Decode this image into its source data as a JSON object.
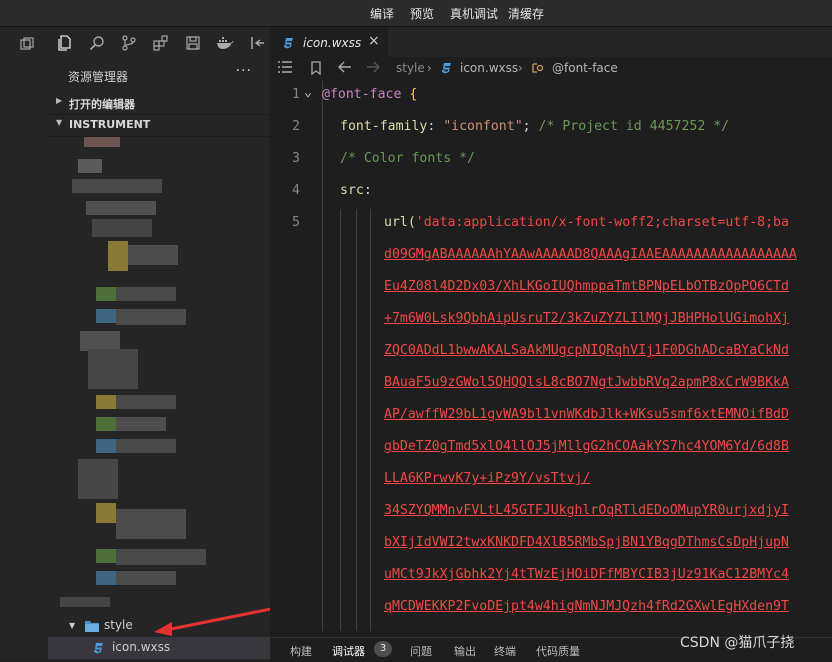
{
  "menu": [
    "编译",
    "预览",
    "真机调试",
    "清缓存"
  ],
  "tab": {
    "label": "icon.wxss",
    "close": "×"
  },
  "breadcrumb": {
    "folder": "style",
    "file": "icon.wxss",
    "symbol": "@font-face"
  },
  "explorer": {
    "title": "资源管理器",
    "more": "···",
    "open_editors": "打开的编辑器",
    "project": "INSTRUMENT",
    "folder": "style",
    "file": "icon.wxss"
  },
  "code": {
    "line_numbers": [
      "1",
      "2",
      "3",
      "4",
      "5"
    ],
    "lines": [
      {
        "l1_at": "@font-face",
        "l1_brace": "{"
      },
      {
        "prop": "font-family",
        "colon": ": ",
        "str": "\"iconfont\"",
        "semi": "; ",
        "comment": "/* Project id 4457252 */"
      },
      {
        "comment": "/* Color fonts */"
      },
      {
        "prop": "src",
        "colon": ":"
      },
      {
        "fn": "url(",
        "str": "'data:application/x-font-woff2;charset=utf-8;ba"
      }
    ],
    "data_lines": [
      "d09GMgABAAAAAAhYAAwAAAAAD8QAAAgIAAEAAAAAAAAAAAAAAAAA",
      "Eu4Z08l4D2Dx03/XhLKGoIUQhmppaTmtBPNpELbOTBzOpPO6CTd",
      "+7m6W0Lsk9QbhAipUsruT2/3kZuZYZLIlMQjJBHPHolUGimohXj",
      "ZQC0ADdL1bwwAKALSaAkMUgcpNIQRqhVIj1F0DGhADcaBYaCkNd",
      "BAuaF5u9zGWol5QHQQlsL8cBO7NgtJwbbRVq2apmP8xCrW9BKkA",
      "AP/awffW29bL1gvWA9bl1vnWKdbJlk+WKsu5smf6xtEMNOifBdD",
      "gbDeTZ0gTmd5xlO4llOJ5jMllgG2hCOAakYS7hc4YOM6Yd/6d8B",
      "LLA6KPrwvK7y+iPz9Y/vsTtvj/",
      "34SZYQMMnvFVLtL45GTFJUkghlrOqRTldEDoOMupYR0urjxdjyI",
      "bXIjIdVWI2twxKNKDFD4XlB5RMbSpjBN1YBqgDThmsCsDpHjupN",
      "uMCt9JkXjGbhk2Yj4tTWzEjHOiDFfMBYCIB3jUz91KaC12BMYc4",
      "qMCDWEKKP2FvoDEjpt4w4higNmNJMJQzh4fRd2GXwlEgHXden9T"
    ]
  },
  "panel_tabs": [
    "构建",
    "调试器",
    "问题",
    "输出",
    "终端",
    "代码质量"
  ],
  "badge": "3",
  "watermark": "CSDN @猫爪子挠",
  "colors": {
    "background": "#1e1e1e",
    "sidebar": "#252526",
    "keyword": "#c586c0",
    "property": "#dcdcaa",
    "string": "#ce9178",
    "comment": "#6a9955",
    "url_string": "#f44747",
    "selected_row": "#37373d",
    "arrow": "#e5322e"
  }
}
